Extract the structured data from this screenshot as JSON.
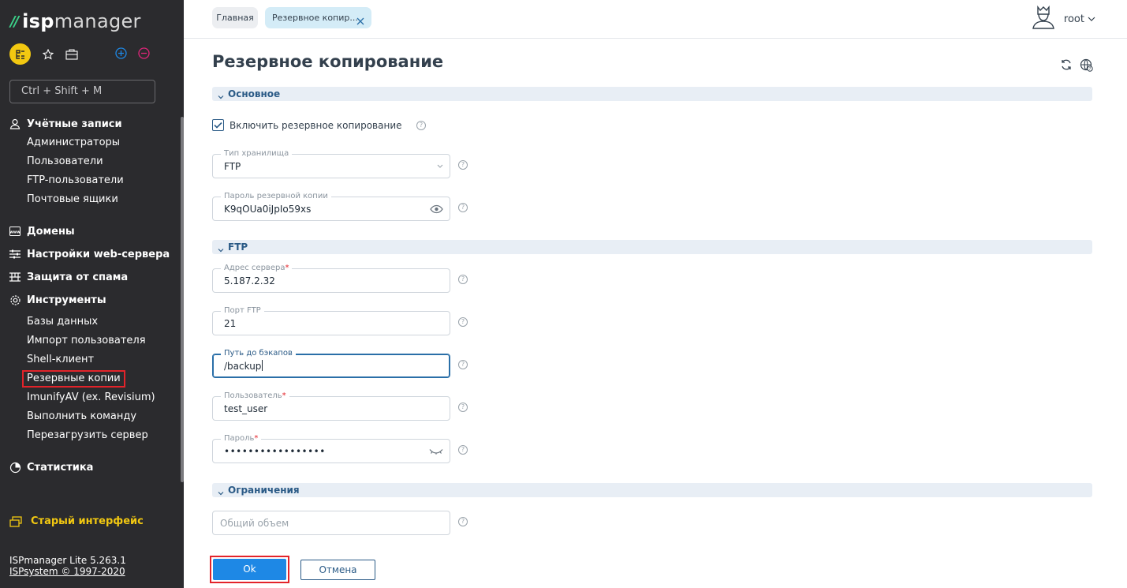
{
  "sidebar": {
    "logo": {
      "brand_bold": "isp",
      "brand_light": "manager"
    },
    "search_placeholder": "Ctrl + Shift + M",
    "sections": {
      "accounts": {
        "label": "Учётные записи",
        "items": [
          "Администраторы",
          "Пользователи",
          "FTP-пользователи",
          "Почтовые ящики"
        ]
      },
      "domains": {
        "label": "Домены"
      },
      "webserver": {
        "label": "Настройки web-сервера"
      },
      "spam": {
        "label": "Защита от спама"
      },
      "tools": {
        "label": "Инструменты",
        "items": [
          "Базы данных",
          "Импорт пользователя",
          "Shell-клиент",
          "Резервные копии",
          "ImunifyAV (ex. Revisium)",
          "Выполнить команду",
          "Перезагрузить сервер"
        ]
      },
      "stats": {
        "label": "Статистика"
      }
    },
    "old_interface": "Старый интерфейс",
    "version_line": "ISPmanager Lite 5.263.1",
    "copyright": "ISPsystem © 1997-2020"
  },
  "topbar": {
    "tab_home": "Главная",
    "tab_current": "Резервное копир...",
    "user": "root"
  },
  "page": {
    "title": "Резервное копирование",
    "groups": {
      "main": "Основное",
      "ftp": "FTP",
      "limits": "Ограничения"
    },
    "enable_backup": {
      "label": "Включить резервное копирование",
      "checked": true
    },
    "fields": {
      "storage_type": {
        "label": "Тип хранилища",
        "value": "FTP"
      },
      "backup_password": {
        "label": "Пароль резервной копии",
        "value": "K9qOUa0iJpIo59xs"
      },
      "server_address": {
        "label": "Адрес сервера",
        "value": "5.187.2.32"
      },
      "ftp_port": {
        "label": "Порт FTP",
        "value": "21"
      },
      "backup_path": {
        "label": "Путь до бэкапов",
        "value": "/backup"
      },
      "user": {
        "label": "Пользователь",
        "value": "test_user"
      },
      "password": {
        "label": "Пароль",
        "value": "•••••••••••••••••"
      },
      "total_volume": {
        "placeholder": "Общий объем"
      }
    },
    "help_symbol": "?",
    "required_mark": "*"
  },
  "buttons": {
    "ok": "Ok",
    "cancel": "Отмена"
  },
  "colors": {
    "sidebar_bg": "#2b2b2e",
    "accent_yellow": "#f2c811",
    "primary_blue": "#1e88e5",
    "highlight_red": "#e3232a"
  }
}
